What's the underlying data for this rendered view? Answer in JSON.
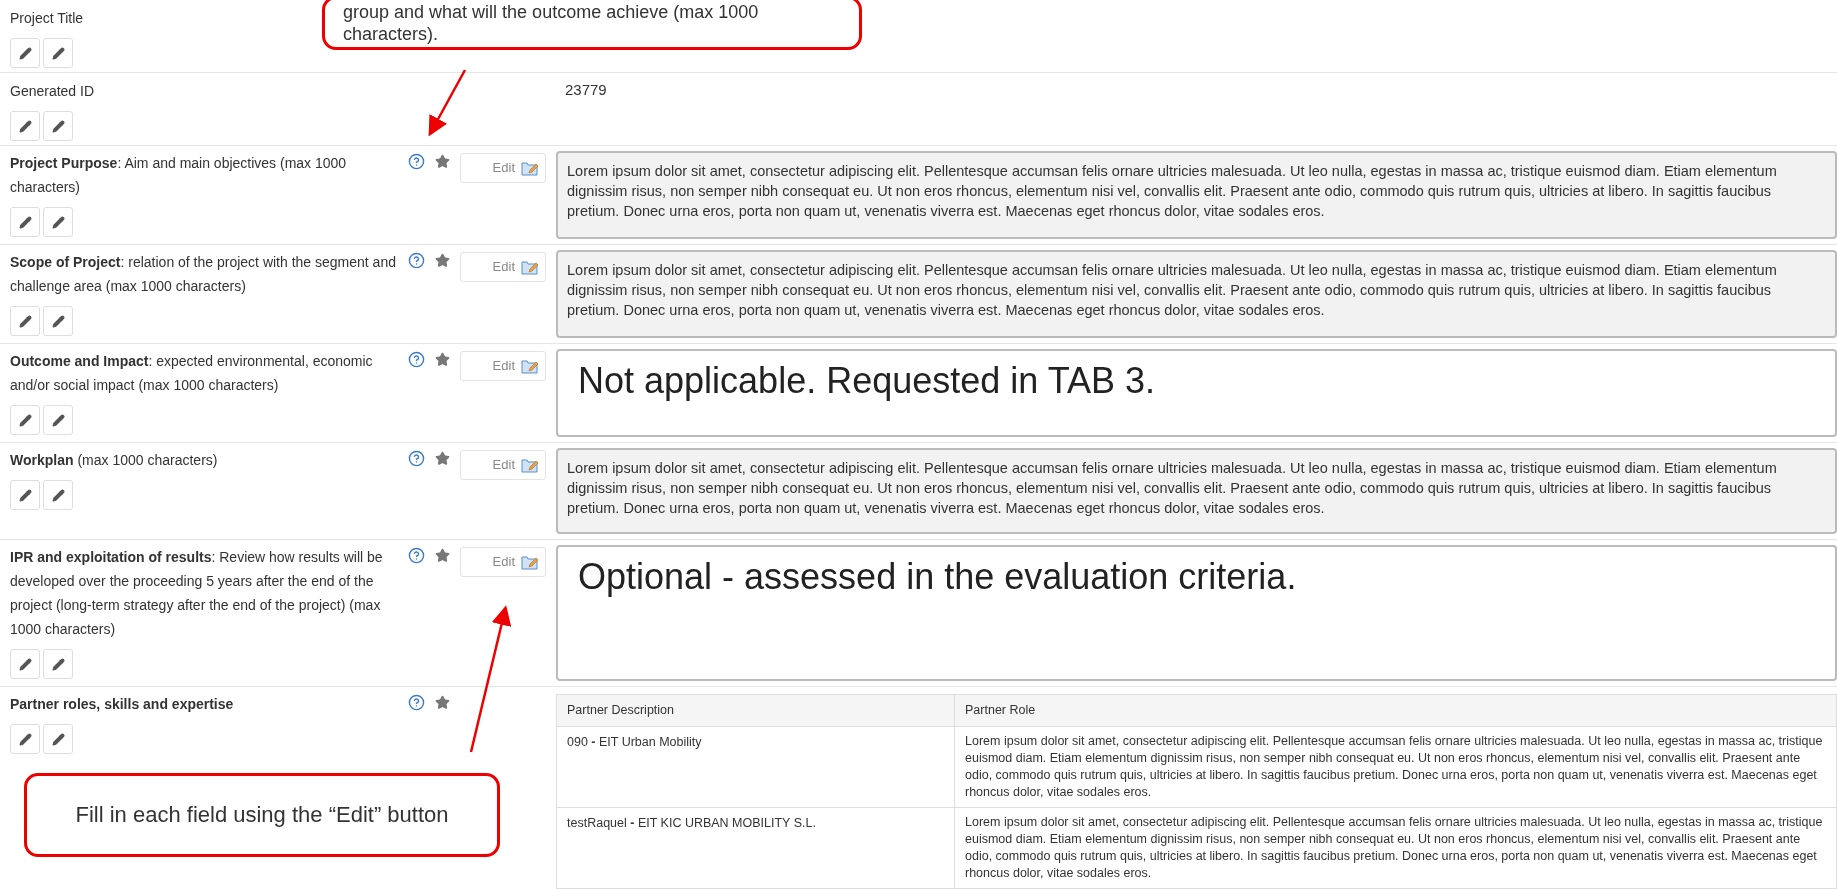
{
  "fields": [
    {
      "kind": "simple",
      "label": "Project Title"
    },
    {
      "kind": "simple",
      "label": "Generated ID",
      "value": "23779"
    },
    {
      "kind": "text",
      "label": "**Project Purpose**: Aim and main objectives (max 1000 characters)",
      "edit": "Edit",
      "value": "Lorem ipsum dolor sit amet, consectetur adipiscing elit. Pellentesque accumsan felis ornare ultricies malesuada. Ut leo nulla, egestas in massa ac, tristique euismod diam. Etiam elementum dignissim risus, non semper nibh consequat eu. Ut non eros rhoncus, elementum nisi vel, convallis elit. Praesent ante odio, commodo quis rutrum quis, ultricies at libero. In sagittis faucibus pretium. Donec urna eros, porta non quam ut, venenatis viverra est. Maecenas eget rhoncus dolor, vitae sodales eros."
    },
    {
      "kind": "text",
      "label": "**Scope of Project**: relation of the project with the segment and challenge area (max 1000 characters)",
      "edit": "Edit",
      "value": "Lorem ipsum dolor sit amet, consectetur adipiscing elit. Pellentesque accumsan felis ornare ultricies malesuada. Ut leo nulla, egestas in massa ac, tristique euismod diam. Etiam elementum dignissim risus, non semper nibh consequat eu. Ut non eros rhoncus, elementum nisi vel, convallis elit. Praesent ante odio, commodo quis rutrum quis, ultricies at libero. In sagittis faucibus pretium. Donec urna eros, porta non quam ut, venenatis viverra est. Maecenas eget rhoncus dolor, vitae sodales eros."
    },
    {
      "kind": "notice",
      "label": "**Outcome and Impact**: expected environmental, economic and/or social impact (max 1000 characters)",
      "edit": "Edit",
      "value": "Not applicable. Requested in TAB 3."
    },
    {
      "kind": "text",
      "label": "**Workplan** (max 1000 characters)",
      "edit": "Edit",
      "value": "Lorem ipsum dolor sit amet, consectetur adipiscing elit. Pellentesque accumsan felis ornare ultricies malesuada. Ut leo nulla, egestas in massa ac, tristique euismod diam. Etiam elementum dignissim risus, non semper nibh consequat eu. Ut non eros rhoncus, elementum nisi vel, convallis elit. Praesent ante odio, commodo quis rutrum quis, ultricies at libero. In sagittis faucibus pretium. Donec urna eros, porta non quam ut, venenatis viverra est. Maecenas eget rhoncus dolor, vitae sodales eros."
    },
    {
      "kind": "notice",
      "label": "**IPR and exploitation of results**: Review how results will be developed over the proceeding 5 years after the end of the project (long-term strategy after the end of the project) (max 1000 characters)",
      "edit": "Edit",
      "value": "Optional - assessed in the evaluation criteria."
    },
    {
      "kind": "table",
      "label": "**Partner roles, skills and expertise**",
      "table": {
        "columns": [
          "Partner Description",
          "Partner Role"
        ],
        "rows": [
          {
            "partner": "090 **-** EIT Urban Mobility",
            "role": "Lorem ipsum dolor sit amet, consectetur adipiscing elit. Pellentesque accumsan felis ornare ultricies malesuada. Ut leo nulla, egestas in massa ac, tristique euismod diam. Etiam elementum dignissim risus, non semper nibh consequat eu. Ut non eros rhoncus, elementum nisi vel, convallis elit. Praesent ante odio, commodo quis rutrum quis, ultricies at libero. In sagittis faucibus pretium. Donec urna eros, porta non quam ut, venenatis viverra est. Maecenas eget rhoncus dolor, vitae sodales eros."
          },
          {
            "partner": "testRaquel **-** EIT KIC URBAN MOBILITY S.L.",
            "role": "Lorem ipsum dolor sit amet, consectetur adipiscing elit. Pellentesque accumsan felis ornare ultricies malesuada. Ut leo nulla, egestas in massa ac, tristique euismod diam. Etiam elementum dignissim risus, non semper nibh consequat eu. Ut non eros rhoncus, elementum nisi vel, convallis elit. Praesent ante odio, commodo quis rutrum quis, ultricies at libero. In sagittis faucibus pretium. Donec urna eros, porta non quam ut, venenatis viverra est. Maecenas eget rhoncus dolor, vitae sodales eros."
          }
        ]
      }
    }
  ],
  "callouts": [
    {
      "kind": "top",
      "text": "group and what will the outcome achieve (max 1000 characters)."
    },
    {
      "kind": "bottom",
      "text": "Fill in each field using the “Edit” button"
    }
  ]
}
